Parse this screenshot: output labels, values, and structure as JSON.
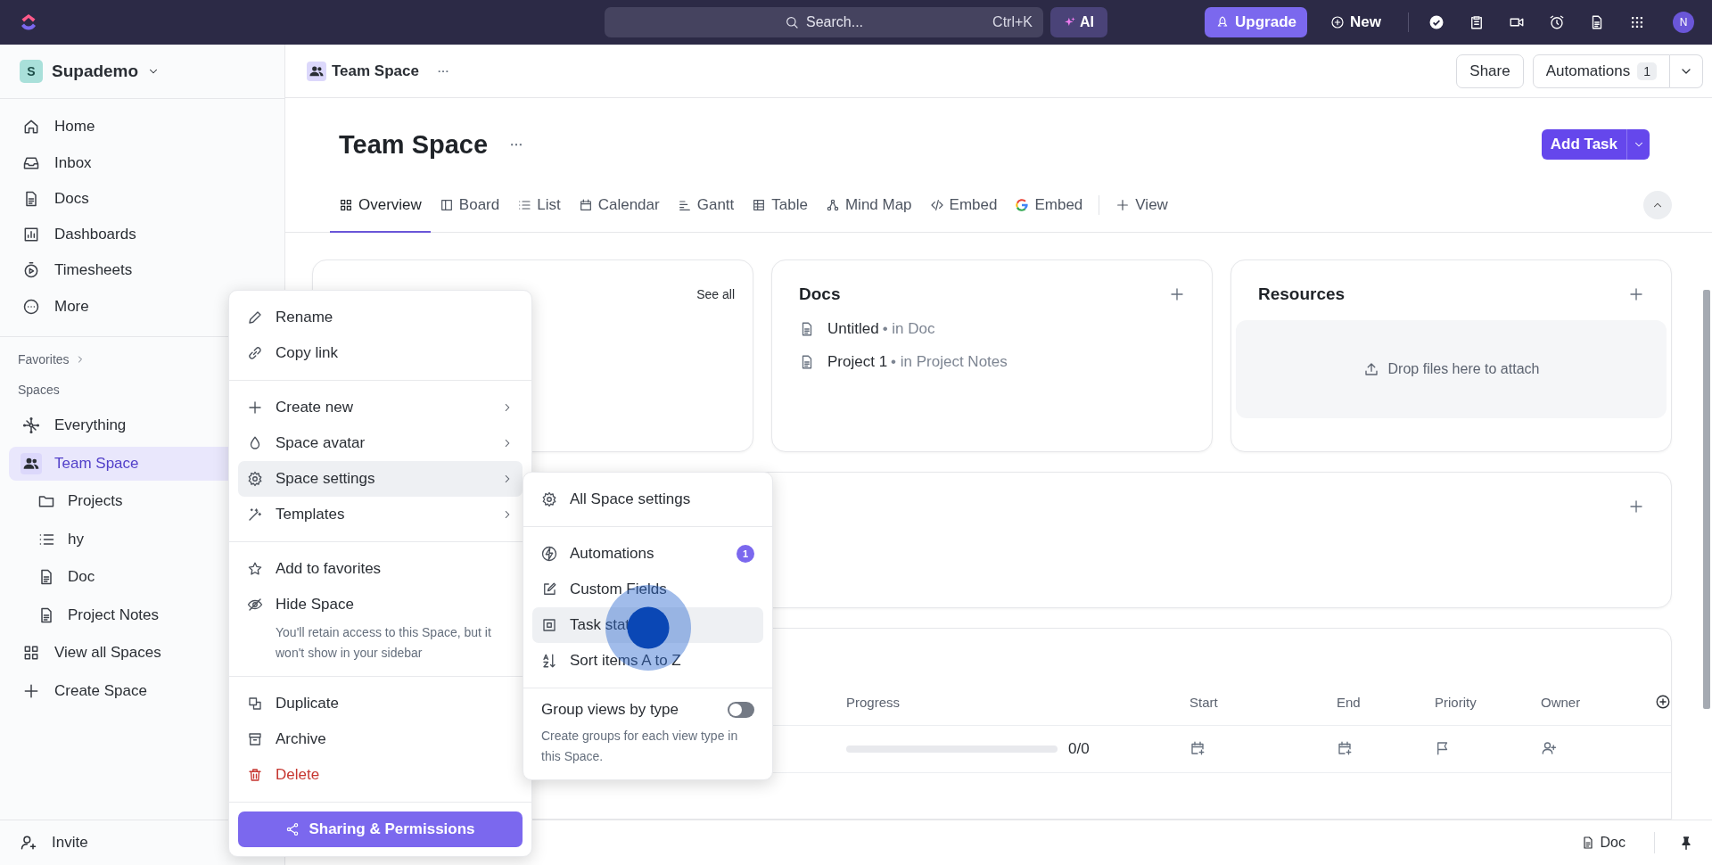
{
  "topbar": {
    "search": {
      "placeholder": "Search...",
      "shortcut": "Ctrl+K"
    },
    "ai_button": "AI",
    "upgrade_button": "Upgrade",
    "new_button": "New",
    "avatar": "N"
  },
  "sidebar": {
    "workspace": {
      "initial": "S",
      "name": "Supademo"
    },
    "nav": [
      {
        "label": "Home",
        "selected": false
      },
      {
        "label": "Inbox",
        "selected": false
      },
      {
        "label": "Docs",
        "selected": false
      },
      {
        "label": "Dashboards",
        "selected": false
      },
      {
        "label": "Timesheets",
        "selected": false
      },
      {
        "label": "More",
        "selected": false
      }
    ],
    "favorites": "Favorites",
    "spaces_heading": "Spaces",
    "spaces": [
      {
        "label": "Everything",
        "selected": false
      },
      {
        "label": "Team Space",
        "selected": true,
        "children": [
          {
            "label": "Projects",
            "selected": false
          },
          {
            "label": "hy",
            "selected": false
          },
          {
            "label": "Doc",
            "selected": false
          },
          {
            "label": "Project Notes",
            "selected": false
          }
        ]
      },
      {
        "label": "View all Spaces",
        "selected": false
      },
      {
        "label": "Create Space",
        "selected": false
      }
    ],
    "invite": "Invite"
  },
  "header": {
    "breadcrumb": "Team Space",
    "share_button": "Share",
    "automations_button": {
      "label": "Automations",
      "count": "1"
    }
  },
  "page": {
    "title": "Team Space",
    "add_task_button": "Add Task",
    "tabs": [
      {
        "label": "Overview",
        "selected": true
      },
      {
        "label": "Board",
        "selected": false
      },
      {
        "label": "List",
        "selected": false
      },
      {
        "label": "Calendar",
        "selected": false
      },
      {
        "label": "Gantt",
        "selected": false
      },
      {
        "label": "Table",
        "selected": false
      },
      {
        "label": "Mind Map",
        "selected": false
      },
      {
        "label": "Embed",
        "selected": false
      },
      {
        "label": "Embed",
        "selected": false
      }
    ],
    "add_view": "View"
  },
  "cards": {
    "first": {
      "link": "See all"
    },
    "docs": {
      "title": "Docs",
      "items": [
        {
          "name": "Untitled",
          "location": "• in Doc"
        },
        {
          "name": "Project 1",
          "location": "• in Project Notes"
        }
      ]
    },
    "resources": {
      "title": "Resources",
      "drop_text": "Drop files here to attach"
    }
  },
  "table": {
    "columns": [
      "Progress",
      "Start",
      "End",
      "Priority",
      "Owner"
    ],
    "rows": [
      {
        "level": 0,
        "count": "0/0"
      }
    ]
  },
  "footer": {
    "doc_button": "Doc"
  },
  "context_menu": {
    "sections": [
      {
        "items": [
          {
            "label": "Rename",
            "submenu": false,
            "selected": false,
            "destructive": false
          },
          {
            "label": "Copy link",
            "submenu": false,
            "selected": false,
            "destructive": false
          }
        ]
      },
      {
        "items": [
          {
            "label": "Create new",
            "submenu": true,
            "selected": false,
            "destructive": false
          },
          {
            "label": "Space avatar",
            "submenu": true,
            "selected": false,
            "destructive": false
          },
          {
            "label": "Space settings",
            "submenu": true,
            "selected": true,
            "destructive": false
          },
          {
            "label": "Templates",
            "submenu": true,
            "selected": false,
            "destructive": false
          }
        ]
      },
      {
        "items": [
          {
            "label": "Add to favorites",
            "submenu": false,
            "selected": false,
            "destructive": false
          },
          {
            "label": "Hide Space",
            "submenu": false,
            "selected": false,
            "destructive": false,
            "description": "You'll retain access to this Space, but it won't show in your sidebar"
          }
        ]
      },
      {
        "items": [
          {
            "label": "Duplicate",
            "submenu": false,
            "selected": false,
            "destructive": false
          },
          {
            "label": "Archive",
            "submenu": false,
            "selected": false,
            "destructive": false
          },
          {
            "label": "Delete",
            "submenu": false,
            "selected": false,
            "destructive": true
          }
        ]
      }
    ],
    "button": "Sharing & Permissions"
  },
  "submenu": {
    "sections": [
      {
        "items": [
          {
            "label": "All Space settings",
            "selected": false
          }
        ]
      },
      {
        "items": [
          {
            "label": "Automations",
            "selected": false,
            "badge": "1"
          },
          {
            "label": "Custom Fields",
            "selected": false
          },
          {
            "label": "Task stat",
            "selected": true
          },
          {
            "label": "Sort items A to Z",
            "selected": false
          }
        ]
      }
    ],
    "toggle": {
      "label": "Group views by type",
      "on": false,
      "description": "Create groups for each view type in this Space."
    }
  }
}
